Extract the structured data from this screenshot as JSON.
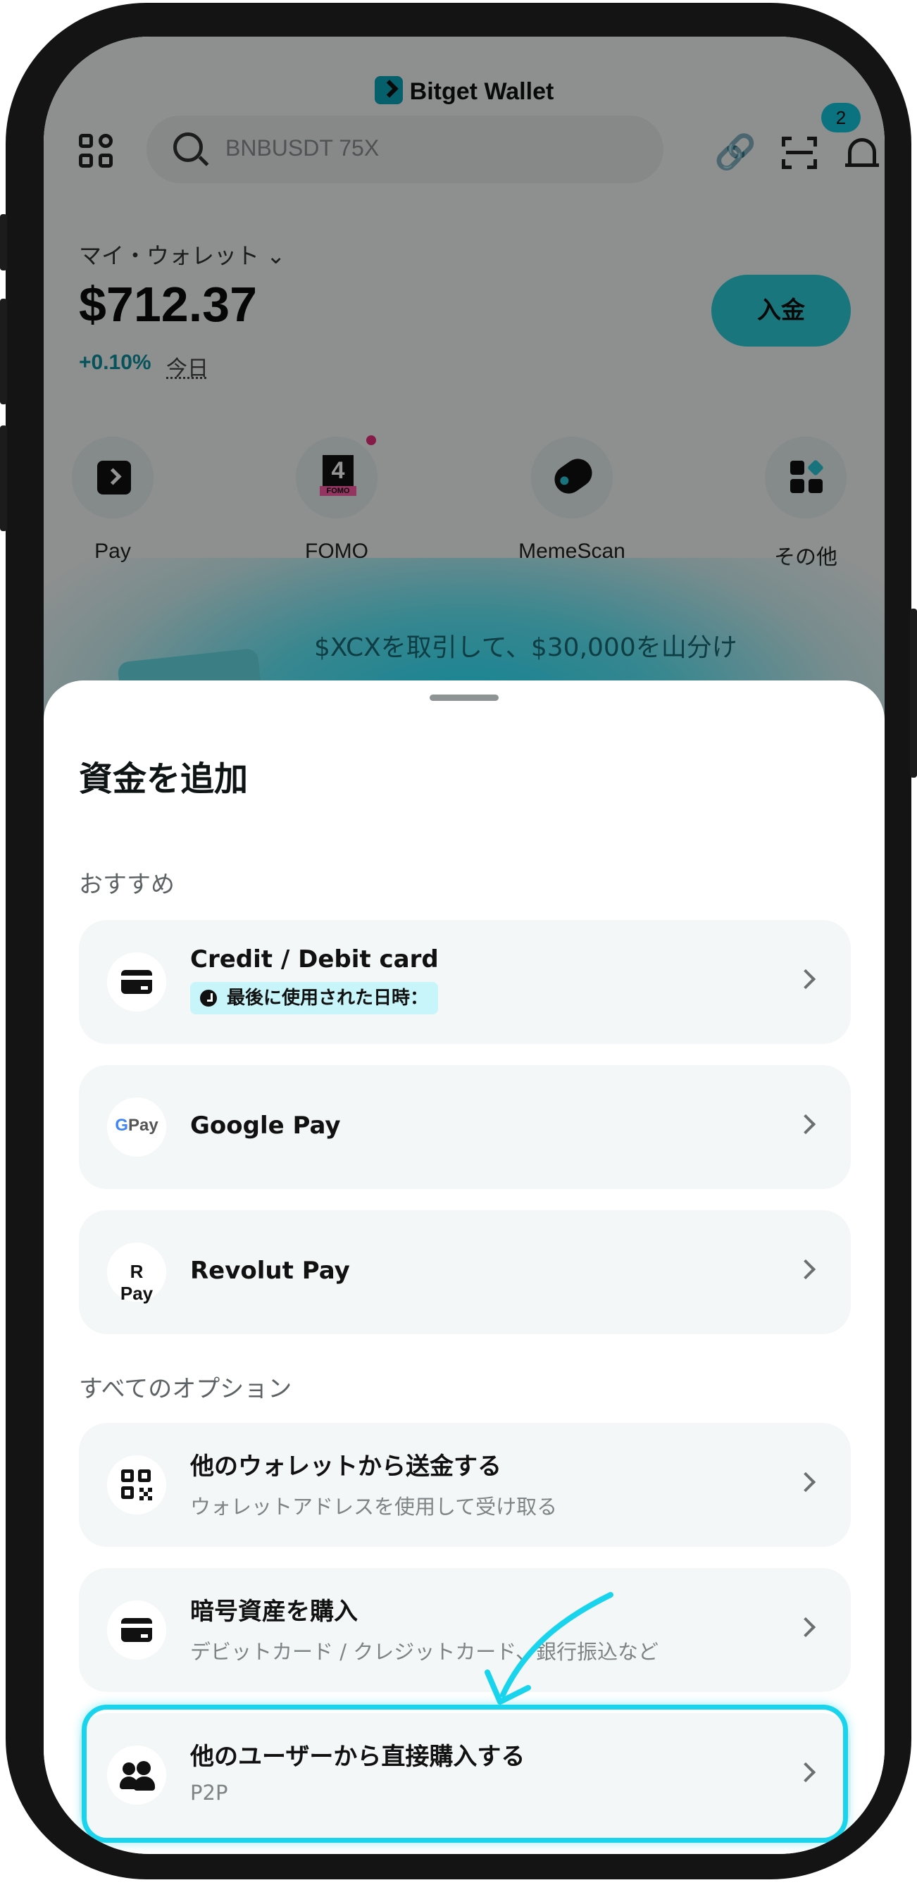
{
  "header": {
    "brand": "Bitget Wallet",
    "search_placeholder": "BNBUSDT 75X",
    "notification_count": "2"
  },
  "wallet": {
    "name": "マイ・ウォレット",
    "balance": "$712.37",
    "change": "+0.10%",
    "change_period": "今日",
    "deposit_label": "入金"
  },
  "quick_actions": [
    {
      "label": "Pay",
      "icon": "pay-icon"
    },
    {
      "label": "FOMO",
      "icon": "fomo-icon"
    },
    {
      "label": "MemeScan",
      "icon": "memescan-icon"
    },
    {
      "label": "その他",
      "icon": "more-icon"
    }
  ],
  "promo": {
    "text": "$XCXを取引して、$30,000を山分け"
  },
  "sheet": {
    "title": "資金を追加",
    "recommended_label": "おすすめ",
    "recommended": [
      {
        "title": "Credit / Debit card",
        "tag": "最後に使用された日時：",
        "icon": "credit-card-icon"
      },
      {
        "title": "Google Pay",
        "icon": "google-pay-icon",
        "icon_text_g": "G",
        "icon_text": "Pay"
      },
      {
        "title": "Revolut Pay",
        "icon": "revolut-pay-icon",
        "icon_text": "R Pay"
      }
    ],
    "all_options_label": "すべてのオプション",
    "all_options": [
      {
        "title": "他のウォレットから送金する",
        "subtitle": "ウォレットアドレスを使用して受け取る",
        "icon": "qr-code-icon"
      },
      {
        "title": "暗号資産を購入",
        "subtitle": "デビットカード / クレジットカード、銀行振込など",
        "icon": "card-icon"
      },
      {
        "title": "他のユーザーから直接購入する",
        "subtitle": "P2P",
        "icon": "users-icon",
        "highlighted": true
      }
    ]
  },
  "colors": {
    "accent": "#19d4ec",
    "positive": "#0d8f9e",
    "deposit_button": "#2ccbd6",
    "badge": "#14c6dc"
  }
}
